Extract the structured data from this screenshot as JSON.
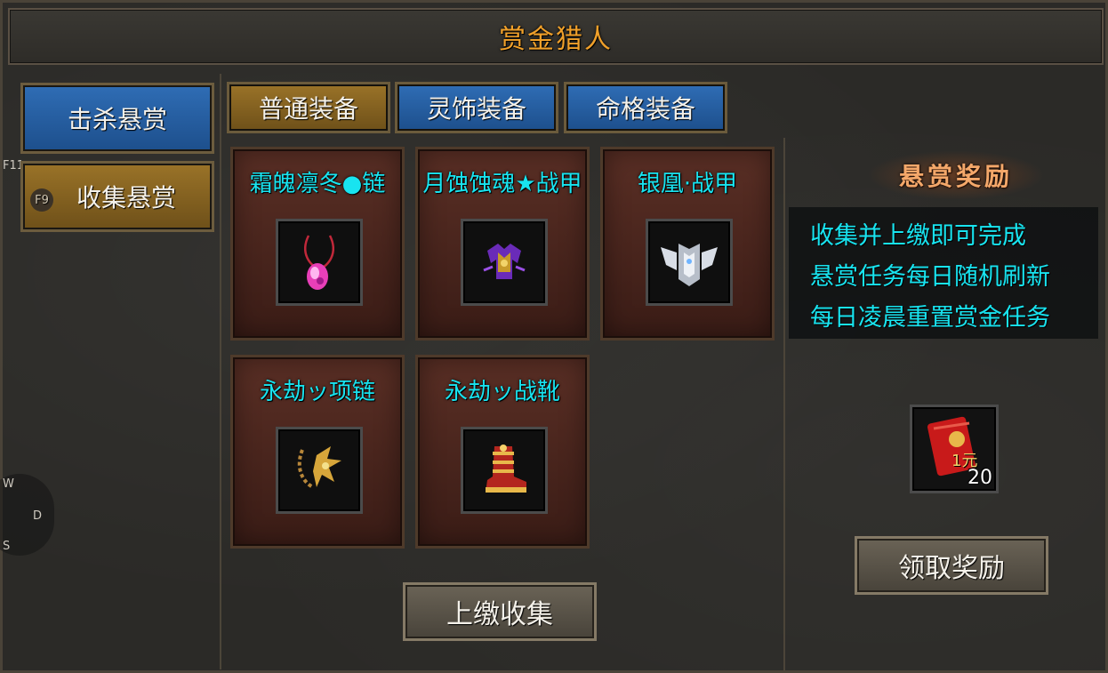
{
  "window": {
    "title": "赏金猎人"
  },
  "sidebar": {
    "items": [
      {
        "label": "击杀悬赏",
        "active": true
      },
      {
        "label": "收集悬赏",
        "hotkey": "F9",
        "active": false
      }
    ],
    "edge_labels": [
      "F11",
      "W",
      "D",
      "S"
    ]
  },
  "tabs": [
    {
      "label": "普通装备",
      "selected": true
    },
    {
      "label": "灵饰装备",
      "selected": false
    },
    {
      "label": "命格装备",
      "selected": false
    }
  ],
  "items": [
    {
      "name": "霜魄凛冬●链",
      "icon": "necklace-pink-gem-icon"
    },
    {
      "name": "月蚀蚀魂★战甲",
      "icon": "armor-purple-icon"
    },
    {
      "name": "银凰·战甲",
      "icon": "armor-silver-wings-icon"
    },
    {
      "name": "永劫ッ项链",
      "icon": "necklace-gold-icon"
    },
    {
      "name": "永劫ッ战靴",
      "icon": "boots-gold-red-icon"
    }
  ],
  "actions": {
    "submit_label": "上缴收集",
    "claim_label": "领取奖励"
  },
  "reward": {
    "header": "悬赏奖励",
    "info_lines": [
      "收集并上缴即可完成",
      "悬赏任务每日随机刷新",
      "每日凌晨重置赏金任务"
    ],
    "item": {
      "icon": "red-envelope-icon",
      "glyph": "1元",
      "count": "20"
    }
  },
  "colors": {
    "title": "#f0a02a",
    "item_name": "#18e4f0",
    "tab_blue": "#2f6db5",
    "tab_gold": "#9a7328"
  }
}
